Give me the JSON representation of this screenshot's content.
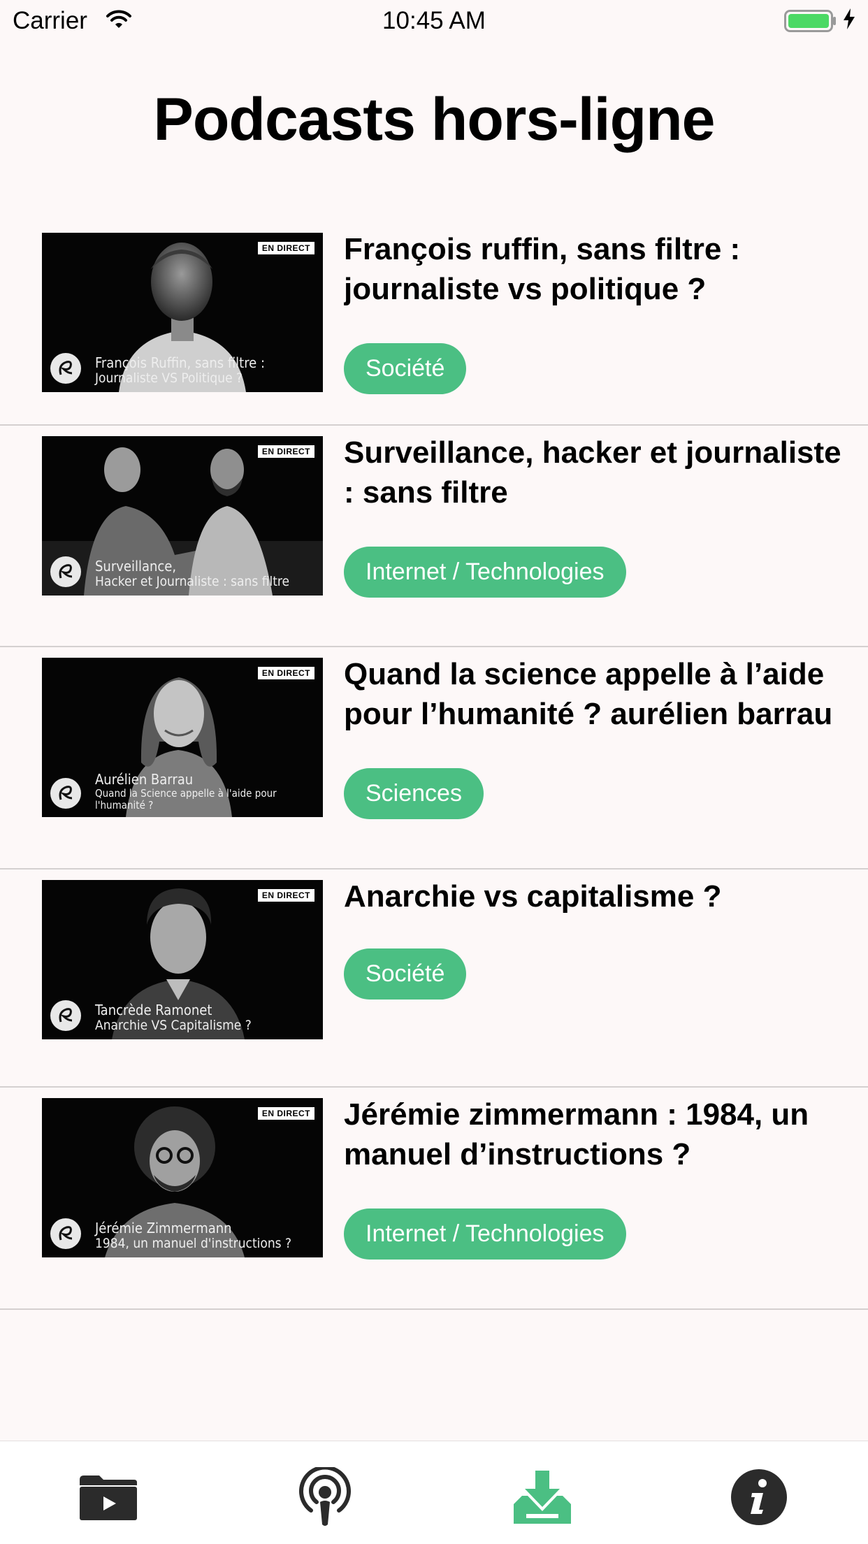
{
  "status_bar": {
    "carrier": "Carrier",
    "time": "10:45 AM"
  },
  "page": {
    "title": "Podcasts hors-ligne"
  },
  "items": [
    {
      "title": "François ruffin, sans filtre : journaliste vs politique ?",
      "category": "Société",
      "thumbnail": {
        "badge": "EN DIRECT",
        "caption_line1": "François Ruffin, sans filtre :",
        "caption_line2": "Journaliste VS Politique ?"
      }
    },
    {
      "title": "Surveillance, hacker et journaliste : sans filtre",
      "category": "Internet / Technologies",
      "thumbnail": {
        "badge": "EN DIRECT",
        "caption_line1": "Surveillance,",
        "caption_line2": "Hacker et Journaliste : sans filtre"
      }
    },
    {
      "title": "Quand la science appelle à l’aide pour l’humanité ? aurélien barrau",
      "category": "Sciences",
      "thumbnail": {
        "badge": "EN DIRECT",
        "caption_line1": "Aurélien Barrau",
        "caption_line2": "Quand la Science appelle à l'aide pour l'humanité ?"
      }
    },
    {
      "title": "Anarchie vs capitalisme ?",
      "category": "Société",
      "thumbnail": {
        "badge": "EN DIRECT",
        "caption_line1": "Tancrède Ramonet",
        "caption_line2": "Anarchie VS Capitalisme ?"
      }
    },
    {
      "title": "Jérémie zimmermann : 1984, un manuel d’instructions ?",
      "category": "Internet / Technologies",
      "thumbnail": {
        "badge": "EN DIRECT",
        "caption_line1": "Jérémie Zimmermann",
        "caption_line2": "1984, un manuel d'instructions ?"
      }
    }
  ],
  "tab_bar": {
    "tabs": [
      {
        "icon": "video-folder-icon",
        "active": false
      },
      {
        "icon": "podcast-icon",
        "active": false
      },
      {
        "icon": "download-icon",
        "active": true
      },
      {
        "icon": "info-icon",
        "active": false
      }
    ],
    "active_color": "#4bbf83",
    "inactive_color": "#2b2b2b"
  },
  "colors": {
    "accent": "#4bbf83",
    "background": "#fdf8f8",
    "divider": "#d4d0d0"
  }
}
